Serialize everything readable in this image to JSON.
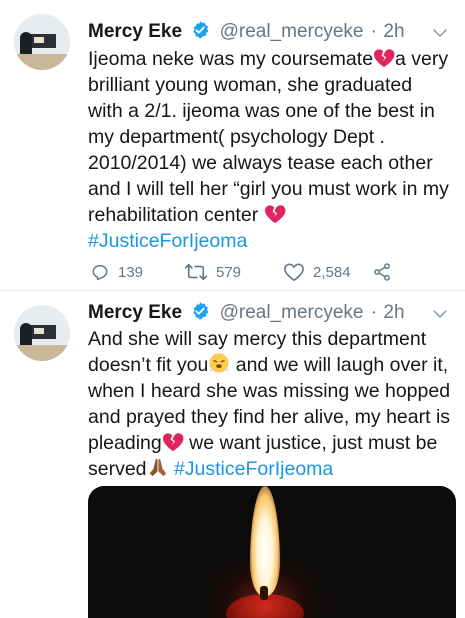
{
  "tweets": [
    {
      "author_name": "Mercy Eke",
      "handle": "@real_mercyeke",
      "separator": "·",
      "time": "2h",
      "lines": [
        "Ijeoma neke was my coursemate",
        "a very",
        "brilliant young woman, she graduated",
        "with a 2/1. ijeoma was one of the best in",
        "my department( psychology Dept .",
        "2010/2014) we always tease each other",
        "and I will tell her “girl you must work in my",
        "rehabilitation center"
      ],
      "hashtag": "#JusticeForIjeoma",
      "replies": "139",
      "retweets": "579",
      "likes": "2,584"
    },
    {
      "author_name": "Mercy Eke",
      "handle": "@real_mercyeke",
      "separator": "·",
      "time": "2h",
      "lines": [
        "And she will say mercy this department",
        "doesn’t fit you",
        " and we will laugh over it,",
        "when I heard she was missing we hopped",
        "and prayed they find her alive, my heart is",
        "pleading",
        " we want justice, just must be",
        "served"
      ],
      "hashtag": "#JusticeForIjeoma"
    }
  ],
  "icons": {
    "verified": "verified-badge-icon",
    "caret": "chevron-down-icon",
    "reply": "reply-icon",
    "retweet": "retweet-icon",
    "like": "heart-icon",
    "share": "share-icon",
    "broken_heart": "broken-heart-emoji",
    "steam_face": "face-with-steam-emoji",
    "praying_hands": "folded-hands-emoji"
  },
  "colors": {
    "text": "#14171a",
    "secondary": "#657786",
    "link": "#1b95e0",
    "verified": "#1da1f2",
    "broken_heart": "#e0245e"
  }
}
